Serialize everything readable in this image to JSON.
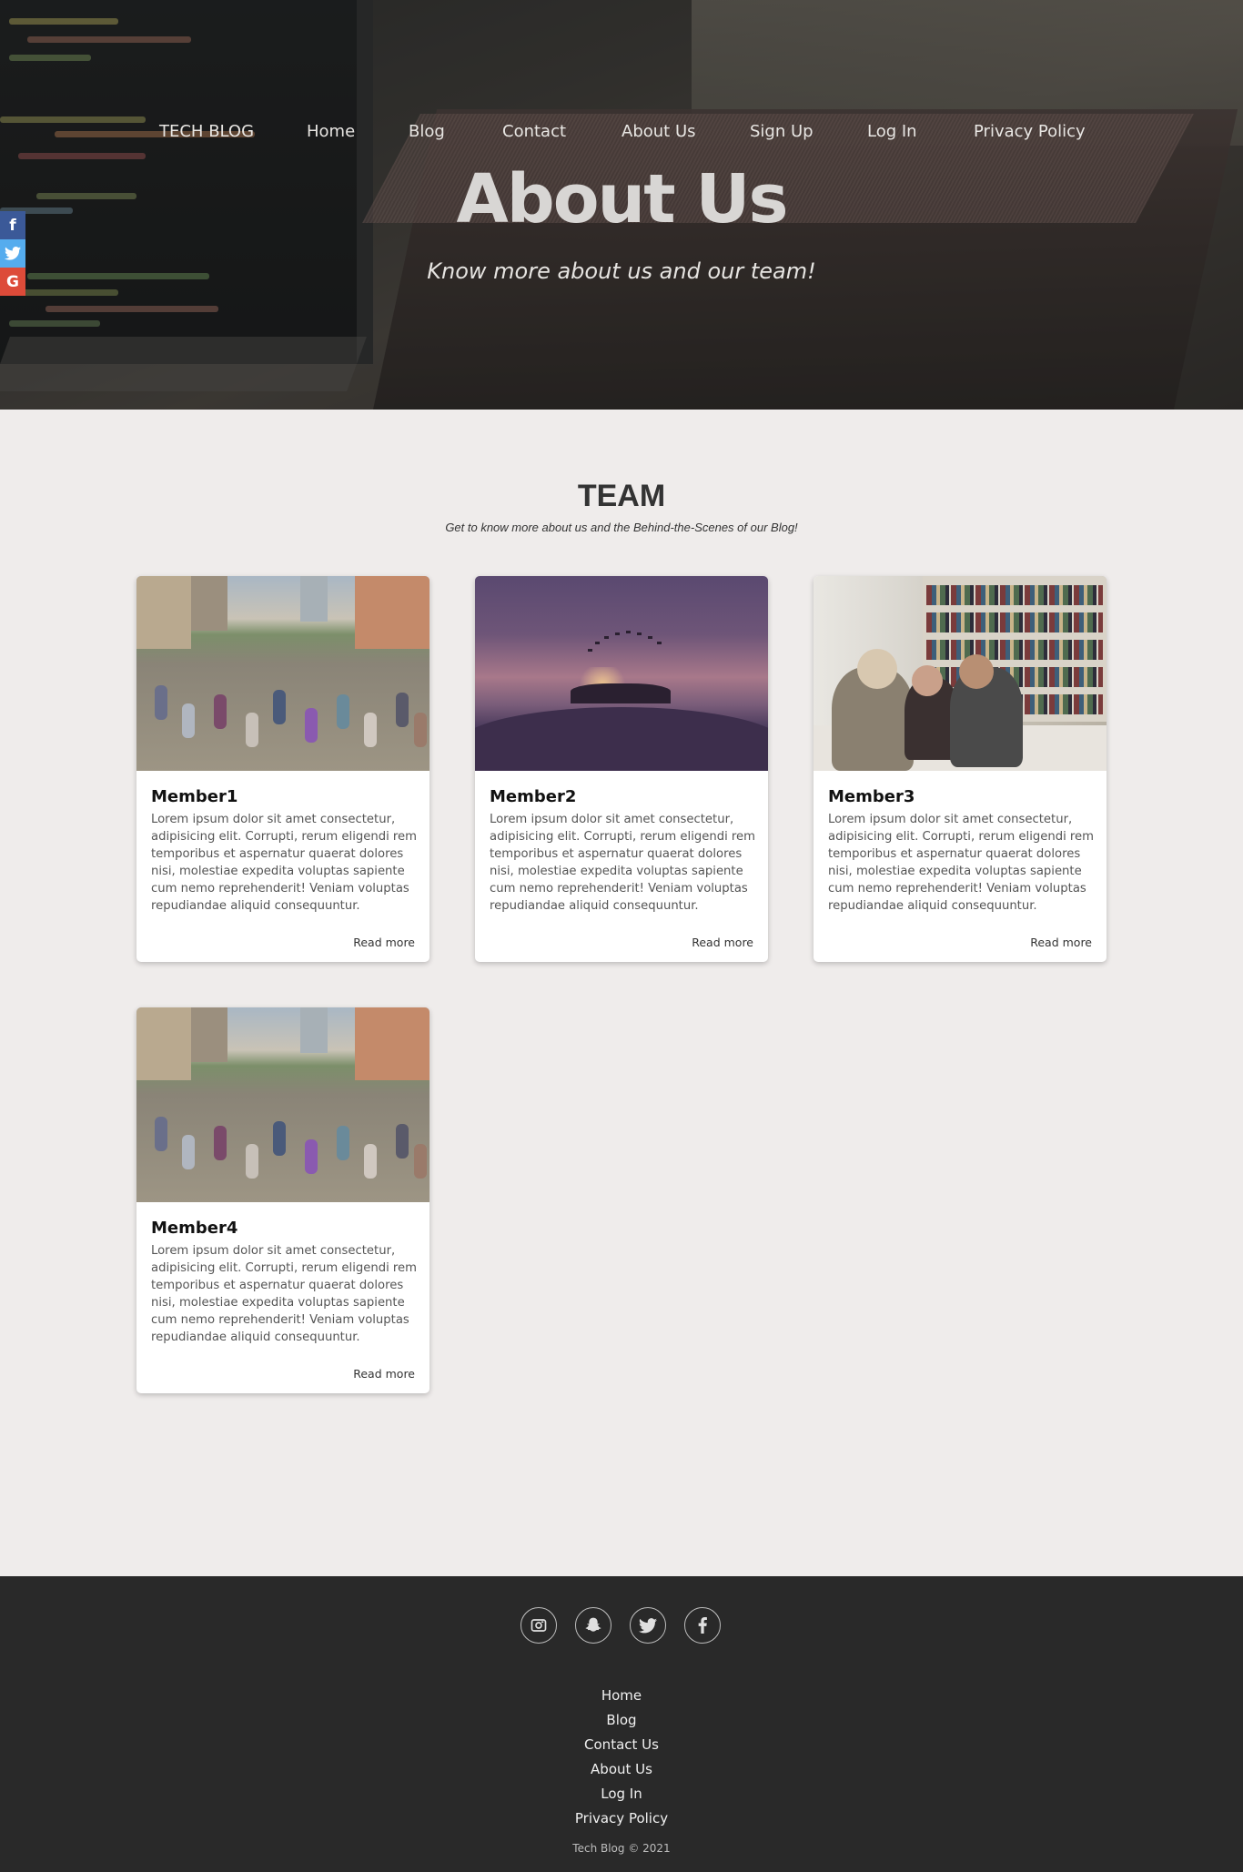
{
  "nav": {
    "brand": "TECH BLOG",
    "items": [
      "Home",
      "Blog",
      "Contact",
      "About Us",
      "Sign Up",
      "Log In",
      "Privacy Policy"
    ]
  },
  "hero": {
    "title": "About Us",
    "subtitle": "Know more about us and our team!"
  },
  "side_social": [
    {
      "icon": "facebook-icon",
      "glyph": "f",
      "color": "#3b5998"
    },
    {
      "icon": "twitter-icon",
      "glyph": "t",
      "color": "#55acee"
    },
    {
      "icon": "google-icon",
      "glyph": "G",
      "color": "#dd4b39"
    }
  ],
  "team": {
    "title": "TEAM",
    "subtitle": "Get to know more about us and the Behind-the-Scenes of our Blog!",
    "members": [
      {
        "name": "Member1",
        "image": "crowd-photo",
        "text": "Lorem ipsum dolor sit amet consectetur, adipisicing elit. Corrupti, rerum eligendi rem temporibus et aspernatur quaerat dolores nisi, molestiae expedita voluptas sapiente cum nemo reprehenderit! Veniam voluptas repudiandae aliquid consequuntur.",
        "link": "Read more"
      },
      {
        "name": "Member2",
        "image": "sunset-graduation-photo",
        "text": "Lorem ipsum dolor sit amet consectetur, adipisicing elit. Corrupti, rerum eligendi rem temporibus et aspernatur quaerat dolores nisi, molestiae expedita voluptas sapiente cum nemo reprehenderit! Veniam voluptas repudiandae aliquid consequuntur.",
        "link": "Read more"
      },
      {
        "name": "Member3",
        "image": "library-students-photo",
        "text": "Lorem ipsum dolor sit amet consectetur, adipisicing elit. Corrupti, rerum eligendi rem temporibus et aspernatur quaerat dolores nisi, molestiae expedita voluptas sapiente cum nemo reprehenderit! Veniam voluptas repudiandae aliquid consequuntur.",
        "link": "Read more"
      },
      {
        "name": "Member4",
        "image": "crowd-photo",
        "text": "Lorem ipsum dolor sit amet consectetur, adipisicing elit. Corrupti, rerum eligendi rem temporibus et aspernatur quaerat dolores nisi, molestiae expedita voluptas sapiente cum nemo reprehenderit! Veniam voluptas repudiandae aliquid consequuntur.",
        "link": "Read more"
      }
    ]
  },
  "footer": {
    "social_icons": [
      "instagram-icon",
      "snapchat-icon",
      "twitter-icon",
      "facebook-icon"
    ],
    "links": [
      "Home",
      "Blog",
      "Contact Us",
      "About Us",
      "Log In",
      "Privacy Policy"
    ],
    "copyright": "Tech Blog © 2021"
  }
}
